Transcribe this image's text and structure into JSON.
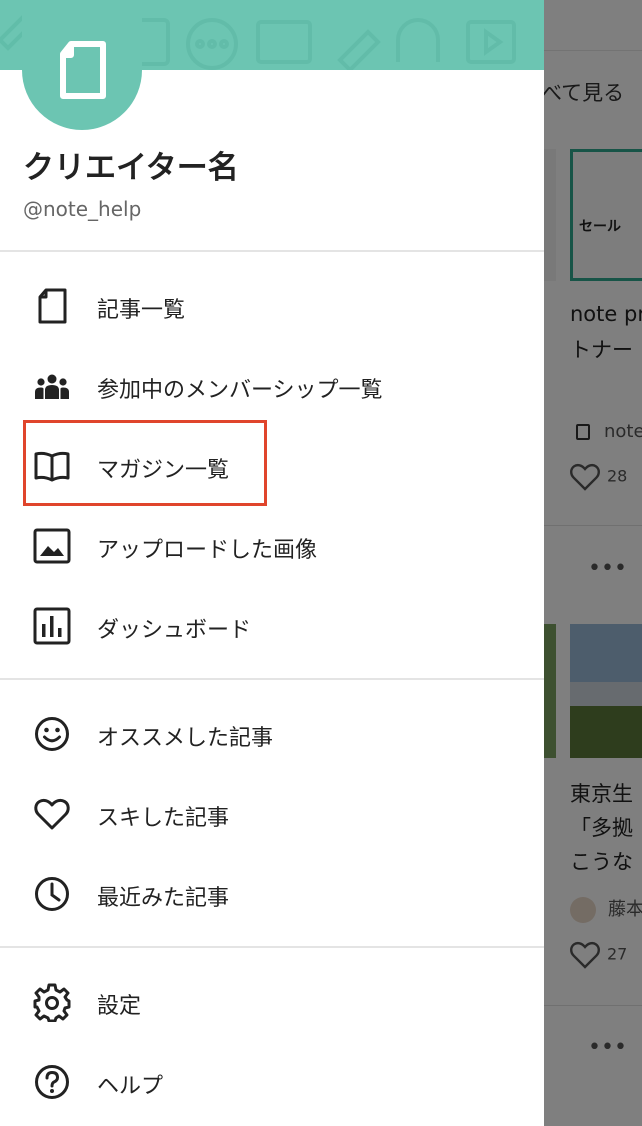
{
  "drawer": {
    "creator_name": "クリエイター名",
    "handle": "@note_help",
    "sections": [
      {
        "items": [
          {
            "label": "記事一覧",
            "icon": "note-icon"
          },
          {
            "label": "参加中のメンバーシップ一覧",
            "icon": "people-icon"
          },
          {
            "label": "マガジン一覧",
            "icon": "book-icon",
            "highlighted": true
          },
          {
            "label": "アップロードした画像",
            "icon": "image-icon"
          },
          {
            "label": "ダッシュボード",
            "icon": "chart-icon"
          }
        ]
      },
      {
        "items": [
          {
            "label": "オススメした記事",
            "icon": "smile-icon"
          },
          {
            "label": "スキした記事",
            "icon": "heart-icon"
          },
          {
            "label": "最近みた記事",
            "icon": "clock-icon"
          }
        ]
      },
      {
        "items": [
          {
            "label": "設定",
            "icon": "gear-icon"
          },
          {
            "label": "ヘルプ",
            "icon": "help-icon"
          }
        ]
      }
    ],
    "highlight_color": "#e0452c",
    "header_color": "#6cc5b2"
  },
  "background": {
    "see_all": "べて見る",
    "card1": {
      "thumb_text": "セール",
      "title_line1": "note pr",
      "title_line2": "トナー",
      "author": "note",
      "likes": "28"
    },
    "card2": {
      "title_line1": "東京生",
      "title_line2": "「多拠",
      "title_line3": "こうな",
      "author": "藤本",
      "likes": "27"
    }
  }
}
